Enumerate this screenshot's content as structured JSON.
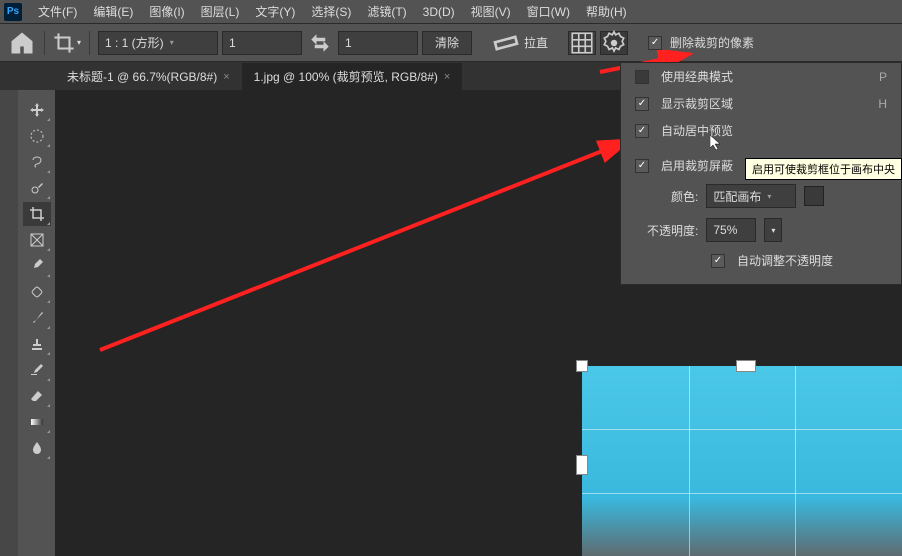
{
  "menu": {
    "file": "文件(F)",
    "edit": "编辑(E)",
    "image": "图像(I)",
    "layer": "图层(L)",
    "type": "文字(Y)",
    "select": "选择(S)",
    "filter": "滤镜(T)",
    "threed": "3D(D)",
    "view": "视图(V)",
    "window": "窗口(W)",
    "help": "帮助(H)"
  },
  "opt": {
    "ratio": "1 : 1 (方形)",
    "w": "1",
    "h": "1",
    "clear": "清除",
    "straighten": "拉直",
    "delete": "删除裁剪的像素"
  },
  "tabs": {
    "t1": "未标题-1 @ 66.7%(RGB/8#)",
    "t2": "1.jpg @ 100% (裁剪预览, RGB/8#)"
  },
  "popup": {
    "classic": "使用经典模式",
    "classicKey": "P",
    "show": "显示裁剪区域",
    "showKey": "H",
    "center": "自动居中预览",
    "shield": "启用裁剪屏蔽",
    "colorLbl": "颜色:",
    "colorVal": "匹配画布",
    "opacityLbl": "不透明度:",
    "opacityVal": "75%",
    "autoOpacity": "自动调整不透明度"
  },
  "tooltip": "启用可使裁剪框位于画布中央"
}
